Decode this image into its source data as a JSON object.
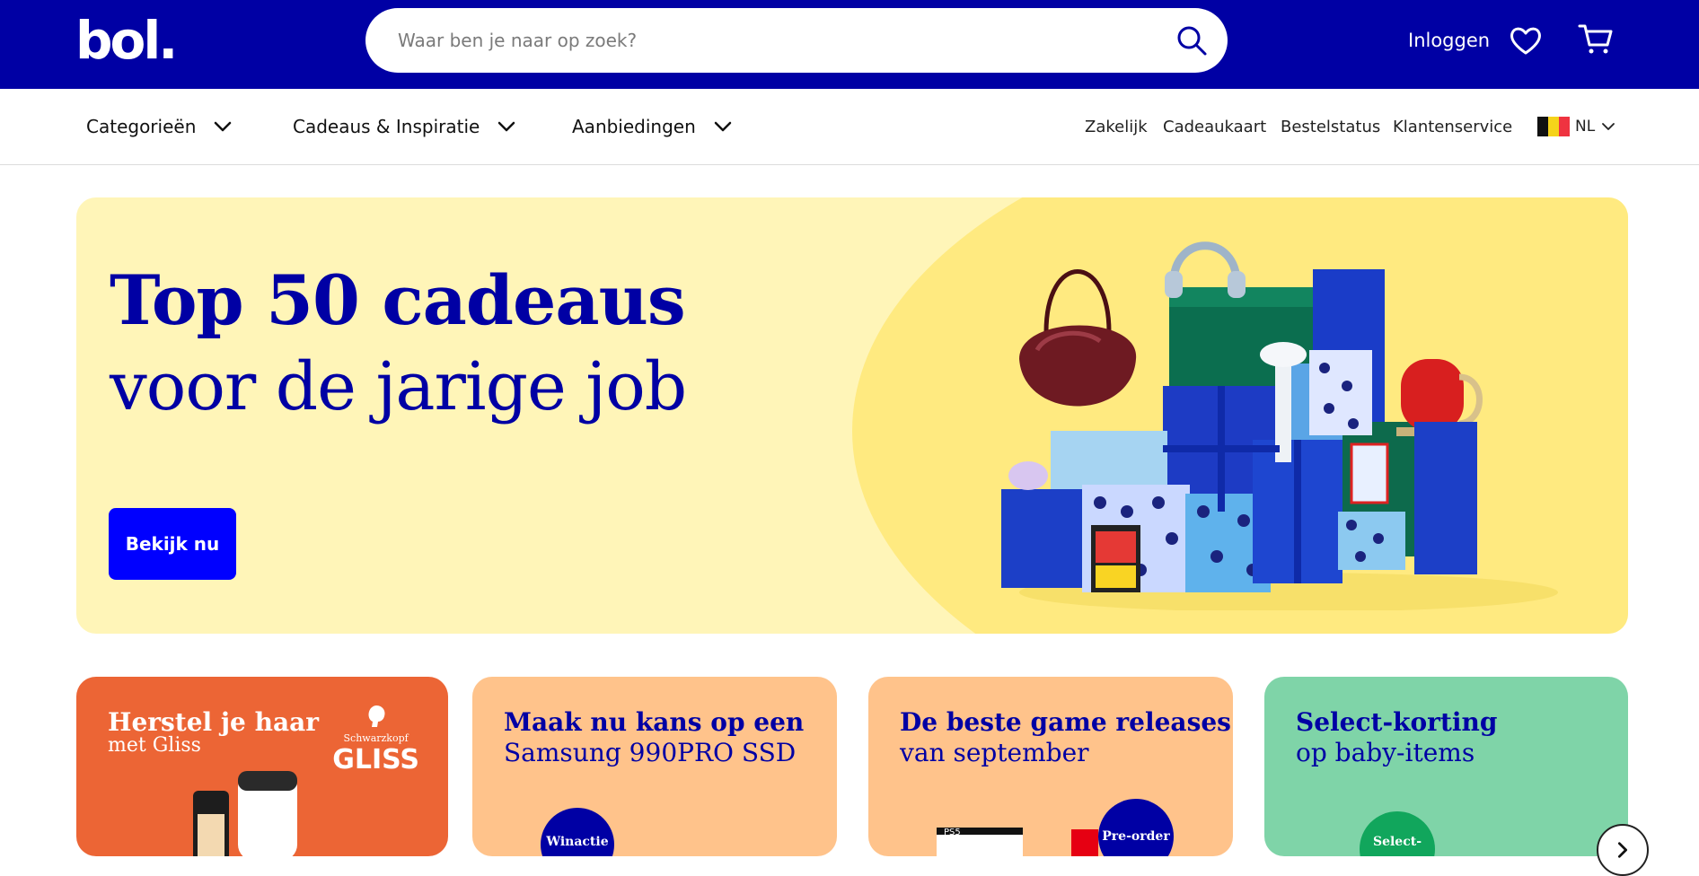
{
  "header": {
    "logo": "bol.",
    "search_placeholder": "Waar ben je naar op zoek?",
    "login_label": "Inloggen",
    "icons": [
      "search-icon",
      "heart-icon",
      "cart-icon"
    ],
    "brand_color": "#0000a4"
  },
  "nav": {
    "menus": [
      {
        "label": "Categorieën"
      },
      {
        "label": "Cadeaus & Inspiratie"
      },
      {
        "label": "Aanbiedingen"
      }
    ],
    "links": [
      "Zakelijk",
      "Cadeaukaart",
      "Bestelstatus",
      "Klantenservice"
    ],
    "language": "NL"
  },
  "hero": {
    "title": "Top 50 cadeaus",
    "subtitle": "voor de jarige job",
    "button_label": "Bekijk nu",
    "background_color": "#fff5b8"
  },
  "cards": [
    {
      "title": "Herstel je haar",
      "subtitle": "met Gliss",
      "brand_small": "Schwarzkopf",
      "brand_big": "GLISS",
      "color": "#ec6535"
    },
    {
      "title": "Maak nu kans op een",
      "subtitle": "Samsung 990PRO SSD",
      "badge": "Winactie",
      "color": "#ffc38b"
    },
    {
      "title": "De beste game releases",
      "subtitle": "van september",
      "badge": "Pre-order",
      "console_label": "PS5",
      "color": "#ffc38b"
    },
    {
      "title": "Select-korting",
      "subtitle": "op baby-items",
      "badge": "Select-",
      "color": "#7fd4a8"
    }
  ]
}
